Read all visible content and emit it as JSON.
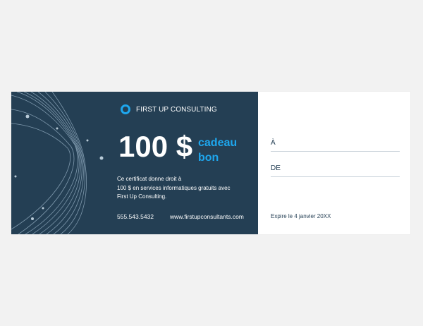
{
  "certificate": {
    "brand": "FIRST UP CONSULTING",
    "amount": "100 $",
    "gift_line1": "cadeau",
    "gift_line2": "bon",
    "description": [
      "Ce certificat donne droit à",
      "100 $ en services informatiques gratuits avec",
      "First Up Consulting."
    ],
    "phone": "555.543.5432",
    "website": "www.firstupconsultants.com",
    "to_label": "À",
    "from_label": "DE",
    "expiry": "Expire le 4 janvier 20XX"
  },
  "icons": {
    "logo": "ring-logo-icon",
    "decoration": "wave-lines-decoration"
  },
  "colors": {
    "background": "#f2f2f2",
    "panel": "#243f54",
    "accent": "#1ea7ee",
    "text_light": "#ffffff",
    "text_dark": "#243f54",
    "divider": "#c9d2da"
  }
}
